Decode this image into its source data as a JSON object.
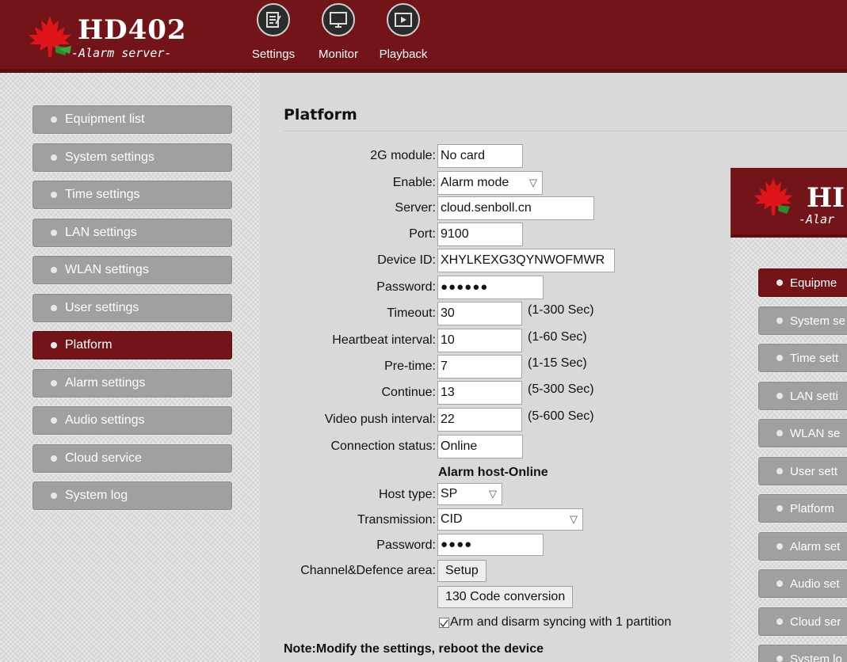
{
  "logo": {
    "title": "HD402",
    "subtitle": "-Alarm server-"
  },
  "topnav": [
    {
      "label": "Settings",
      "icon": "settings-doc-icon"
    },
    {
      "label": "Monitor",
      "icon": "monitor-icon"
    },
    {
      "label": "Playback",
      "icon": "playback-icon"
    }
  ],
  "sidebar": {
    "items": [
      {
        "label": "Equipment list"
      },
      {
        "label": "System settings"
      },
      {
        "label": "Time settings"
      },
      {
        "label": "LAN settings"
      },
      {
        "label": "WLAN settings"
      },
      {
        "label": "User settings"
      },
      {
        "label": "Platform",
        "active": true
      },
      {
        "label": "Alarm settings"
      },
      {
        "label": "Audio settings"
      },
      {
        "label": "Cloud service"
      },
      {
        "label": "System log"
      }
    ]
  },
  "colors": {
    "brand": "#731419",
    "menu_gray": "#a0a0a0",
    "background": "#d9d9d9"
  },
  "page": {
    "title": "Platform"
  },
  "form": {
    "module_2g": {
      "label": "2G module:",
      "value": "No card"
    },
    "enable": {
      "label": "Enable:",
      "value": "Alarm mode"
    },
    "server": {
      "label": "Server:",
      "value": "cloud.senboll.cn"
    },
    "port": {
      "label": "Port:",
      "value": "9100"
    },
    "device_id": {
      "label": "Device ID:",
      "value": "XHYLKEXG3QYNWOFMWR"
    },
    "password": {
      "label": "Password:",
      "value": "●●●●●●"
    },
    "timeout": {
      "label": "Timeout:",
      "value": "30",
      "unit": "(1-300 Sec)"
    },
    "heartbeat": {
      "label": "Heartbeat interval:",
      "value": "10",
      "unit": "(1-60 Sec)"
    },
    "pretime": {
      "label": "Pre-time:",
      "value": "7",
      "unit": "(1-15 Sec)"
    },
    "continue": {
      "label": "Continue:",
      "value": "13",
      "unit": "(5-300 Sec)"
    },
    "video_push": {
      "label": "Video push interval:",
      "value": "22",
      "unit": "(5-600 Sec)"
    },
    "connection": {
      "label": "Connection status:",
      "value": "Online"
    },
    "alarm_host_heading": "Alarm host-Online",
    "host_type": {
      "label": "Host type:",
      "value": "SP"
    },
    "transmission": {
      "label": "Transmission:",
      "value": "CID"
    },
    "host_password": {
      "label": "Password:",
      "value": "●●●●"
    },
    "channel": {
      "label": "Channel&Defence area:",
      "button": "Setup"
    },
    "code_conversion_button": "130 Code conversion",
    "arm_sync": {
      "label": "Arm and disarm syncing with 1 partition",
      "checked": true
    },
    "note": "Note:Modify the settings, reboot the device"
  },
  "overlay": {
    "logo_title": "HI",
    "logo_subtitle": "-Alar",
    "items": [
      {
        "label": "Equipme",
        "active": true
      },
      {
        "label": "System se"
      },
      {
        "label": "Time sett"
      },
      {
        "label": "LAN setti"
      },
      {
        "label": "WLAN se"
      },
      {
        "label": "User sett"
      },
      {
        "label": "Platform"
      },
      {
        "label": "Alarm set"
      },
      {
        "label": "Audio set"
      },
      {
        "label": "Cloud ser"
      },
      {
        "label": "System lo"
      }
    ]
  }
}
